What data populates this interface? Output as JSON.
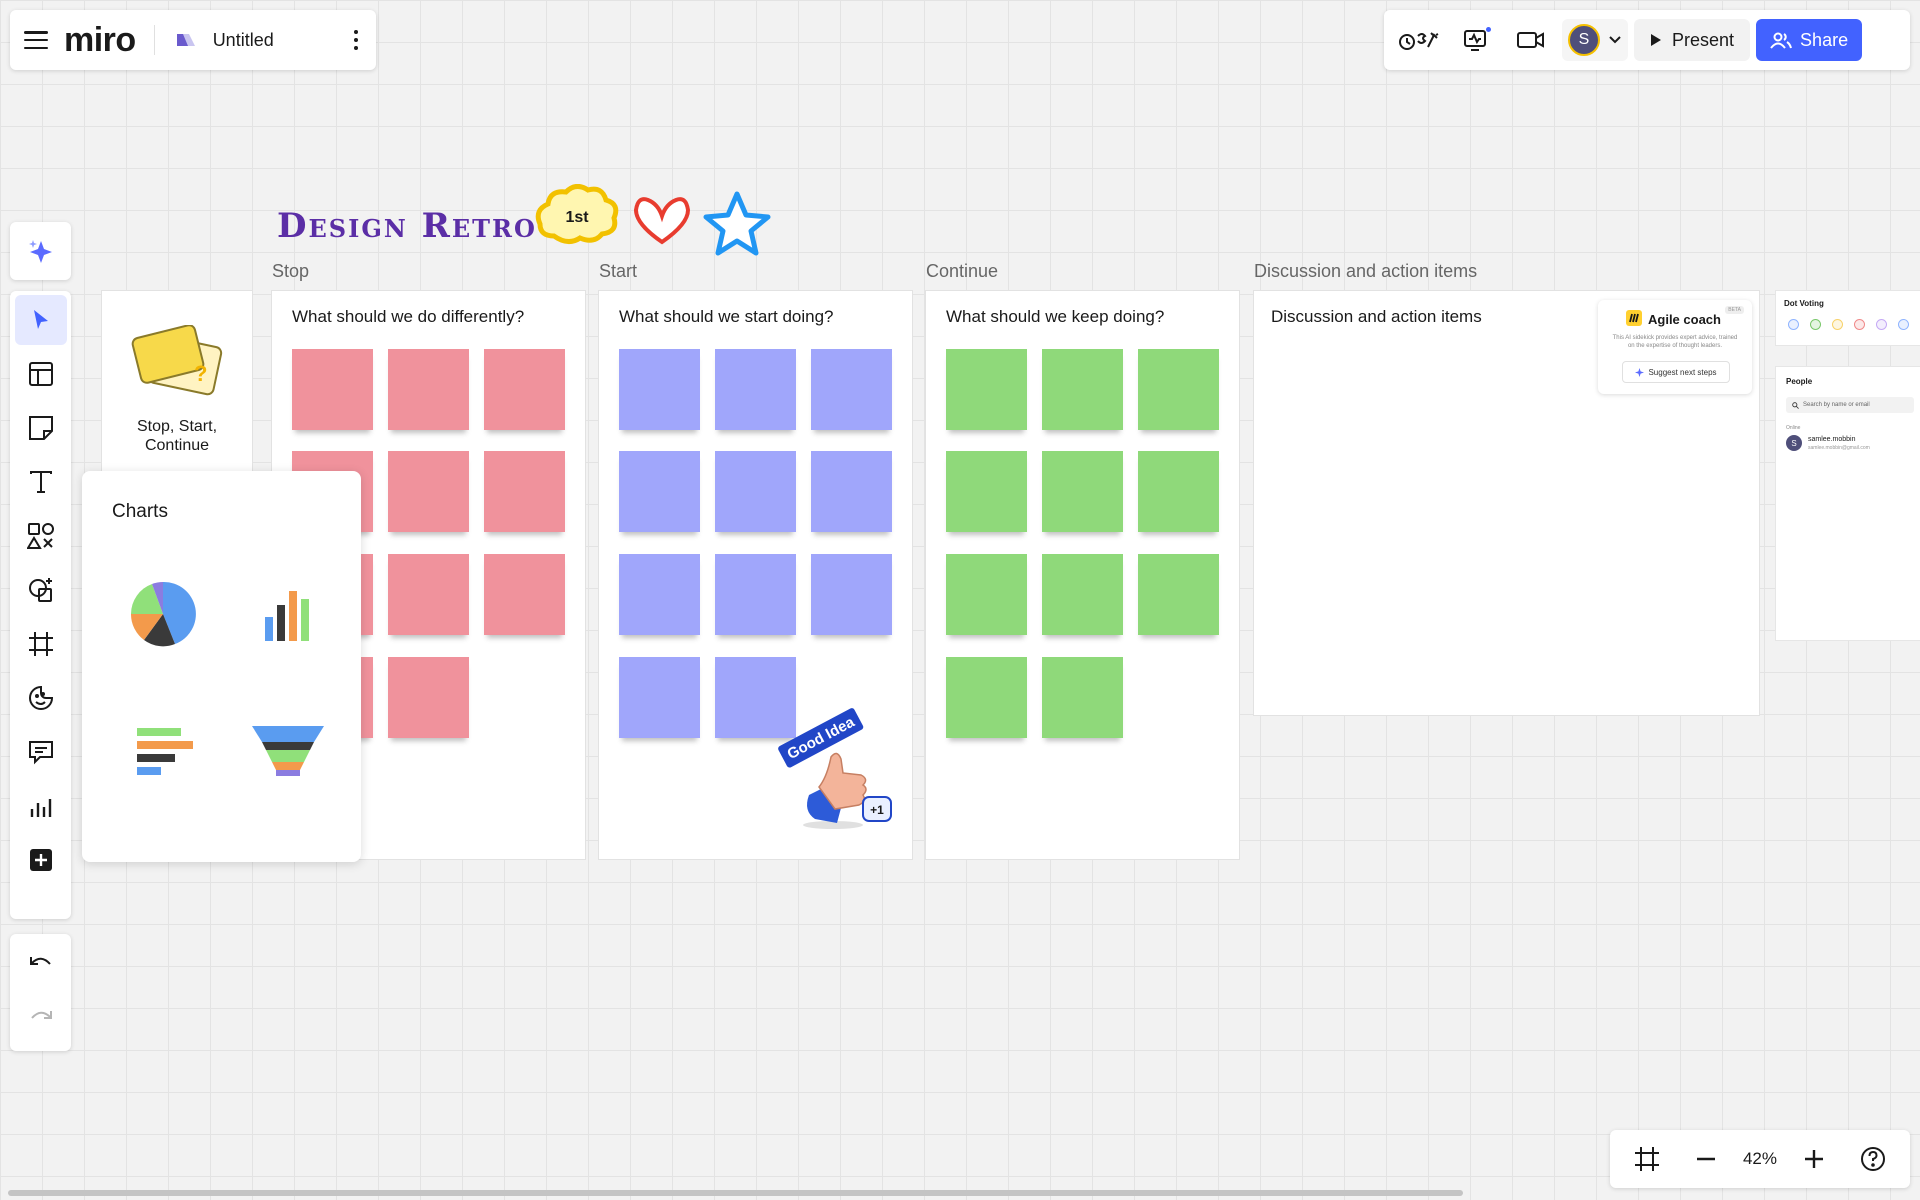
{
  "app": {
    "logo": "miro",
    "board_title": "Untitled"
  },
  "topbar": {
    "present_label": "Present",
    "share_label": "Share",
    "avatar_initial": "S"
  },
  "board": {
    "heading": "Design Retro",
    "sticker_1st": "1st",
    "template_card": {
      "title": "Stop, Start, Continue"
    },
    "frames": [
      {
        "label": "Stop",
        "question": "What should we do differently?",
        "note_color": "#f0929c",
        "note_count": 10
      },
      {
        "label": "Start",
        "question": "What should we start doing?",
        "note_color": "#a0a6fb",
        "note_count": 11
      },
      {
        "label": "Continue",
        "question": "What should we keep doing?",
        "note_color": "#8fd97a",
        "note_count": 11
      },
      {
        "label": "Discussion and action items",
        "question": "Discussion and action items"
      }
    ],
    "good_idea_sticker": {
      "text": "Good Idea",
      "count": "+1"
    },
    "agile_coach": {
      "title": "Agile coach",
      "badge": "BETA",
      "description": "This AI sidekick provides expert advice, trained on the expertise of thought leaders.",
      "button": "Suggest next steps"
    },
    "dot_voting": {
      "title": "Dot Voting",
      "colors": [
        "#8fb4ff",
        "#79c76a",
        "#f7d26a",
        "#f08a8a",
        "#c5a9f5",
        "#8fb4ff"
      ]
    },
    "people": {
      "title": "People",
      "search_placeholder": "Search by name or email",
      "section": "Online",
      "user_name": "samlee.mobbin",
      "user_email": "samlee.mobbin@gmail.com",
      "user_initial": "S"
    }
  },
  "charts_panel": {
    "title": "Charts",
    "items": [
      "pie-chart",
      "bar-chart",
      "horizontal-bar-chart",
      "funnel-chart"
    ]
  },
  "zoom": {
    "value": "42%"
  }
}
